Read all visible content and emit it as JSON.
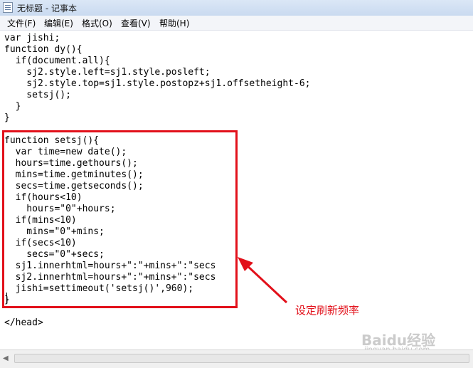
{
  "window": {
    "title": "无标题 - 记事本",
    "icon": "notepad-icon"
  },
  "menu": [
    {
      "label": "文件(F)"
    },
    {
      "label": "编辑(E)"
    },
    {
      "label": "格式(O)"
    },
    {
      "label": "查看(V)"
    },
    {
      "label": "帮助(H)"
    }
  ],
  "code_lines": [
    "var jishi;",
    "function dy(){",
    "  if(document.all){",
    "    sj2.style.left=sj1.style.posleft;",
    "    sj2.style.top=sj1.style.postopz+sj1.offsetheight-6;",
    "    setsj();",
    "  }",
    "}",
    "",
    "function setsj(){",
    "  var time=new date();",
    "  hours=time.gethours();",
    "  mins=time.getminutes();",
    "  secs=time.getseconds();",
    "  if(hours<10)",
    "    hours=\"0\"+hours;",
    "  if(mins<10)",
    "    mins=\"0\"+mins;",
    "  if(secs<10)",
    "    secs=\"0\"+secs;",
    "  sj1.innerhtml=hours+\":\"+mins+\":\"secs",
    "  sj2.innerhtml=hours+\":\"+mins+\":\"secs",
    "  jishi=settimeout('setsj()',960);",
    "}",
    "",
    "</head>"
  ],
  "annotation": {
    "text": "设定刷新频率",
    "color": "#e2101a"
  },
  "watermark": {
    "text": "Baidu经验",
    "sub": "jingyan.baidu.com"
  }
}
